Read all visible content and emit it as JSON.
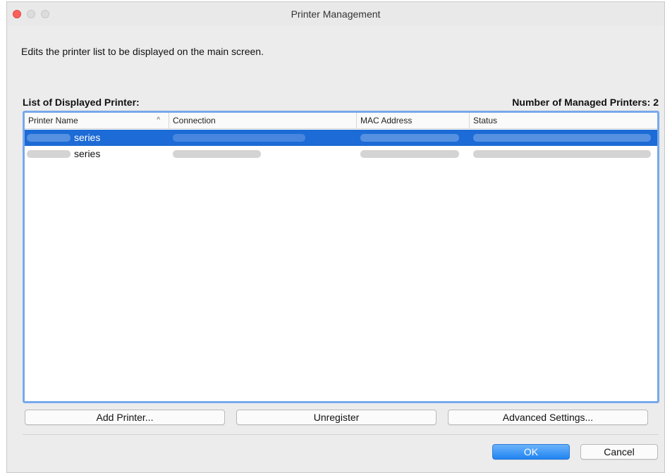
{
  "window": {
    "title": "Printer Management",
    "controls": [
      "close",
      "minimize",
      "zoom"
    ]
  },
  "description": "Edits the printer list to be displayed on the main screen.",
  "list": {
    "label": "List of Displayed Printer:",
    "managed_count_text": "Number of Managed Printers: 2",
    "columns": [
      "Printer Name",
      "Connection",
      "MAC Address",
      "Status"
    ],
    "sort_indicator": "^",
    "rows": [
      {
        "name_suffix": "series",
        "selected": true
      },
      {
        "name_suffix": "series",
        "selected": false
      }
    ]
  },
  "buttons": {
    "add_printer": "Add Printer...",
    "unregister": "Unregister",
    "advanced_settings": "Advanced Settings...",
    "ok": "OK",
    "cancel": "Cancel"
  },
  "colors": {
    "selection": "#1c6bd6",
    "focus_ring": "#77a9ec",
    "ok_button": "#1f84f1",
    "close_button": "#fc605b"
  }
}
